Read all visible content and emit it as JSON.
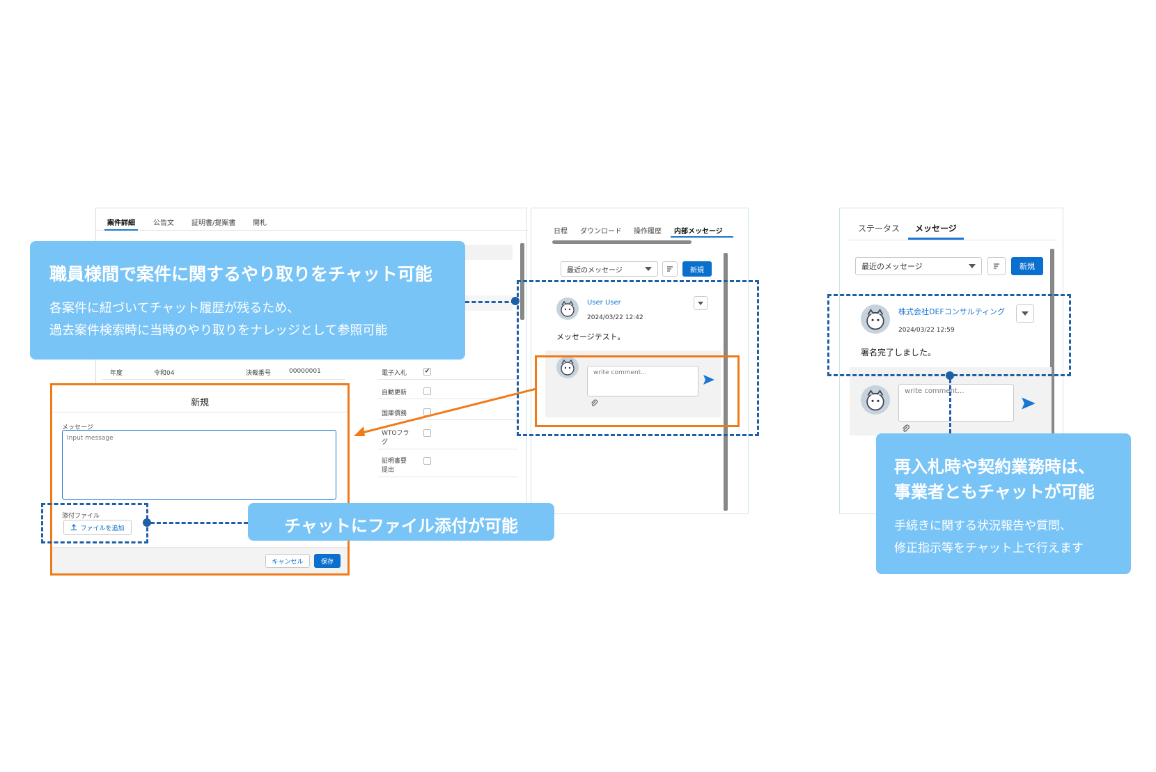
{
  "left_app": {
    "tabs": [
      "案件詳細",
      "公告文",
      "証明書/提案書",
      "開札"
    ],
    "fields": {
      "year_label": "年度",
      "year_value": "令和04",
      "decision_label": "決裁番号",
      "decision_value": "00000001",
      "checks": [
        {
          "label": "電子入札",
          "checked": true,
          "mark": "✔"
        },
        {
          "label": "自動更新",
          "checked": false,
          "mark": ""
        },
        {
          "label": "国庫債務",
          "checked": false,
          "mark": ""
        },
        {
          "label": "WTOフラグ",
          "checked": false,
          "mark": ""
        },
        {
          "label": "証明書要提出",
          "checked": false,
          "mark": ""
        }
      ]
    }
  },
  "modal": {
    "title": "新規",
    "message_label": "メッセージ",
    "message_placeholder": "Input message",
    "attach_label": "添付ファイル",
    "add_file_label": "ファイルを追加",
    "cancel_label": "キャンセル",
    "save_label": "保存"
  },
  "middle_panel": {
    "tabs": [
      "日程",
      "ダウンロード",
      "操作履歴",
      "内部メッセージ"
    ],
    "filter": "最近のメッセージ",
    "new_label": "新規",
    "post": {
      "author": "User User",
      "timestamp": "2024/03/22 12:42",
      "message": "メッセージテスト。"
    },
    "comment_placeholder": "write comment..."
  },
  "right_panel": {
    "tabs": [
      "ステータス",
      "メッセージ"
    ],
    "filter": "最近のメッセージ",
    "new_label": "新規",
    "post": {
      "author": "株式会社DEFコンサルティング",
      "timestamp": "2024/03/22 12:59",
      "message": "署名完了しました。"
    },
    "comment_placeholder": "write comment..."
  },
  "callouts": {
    "top": {
      "title": "職員様間で案件に関するやり取りをチャット可能",
      "line1": "各案件に紐づいてチャット履歴が残るため、",
      "line2": "過去案件検索時に当時のやり取りをナレッジとして参照可能"
    },
    "attach": {
      "title": "チャットにファイル添付が可能"
    },
    "right": {
      "title1": "再入札時や契約業務時は、",
      "title2": "事業者ともチャットが可能",
      "line1": "手続きに関する状況報告や質問、",
      "line2": "修正指示等をチャット上で行えます"
    }
  },
  "colors": {
    "accent_blue": "#0b6fce",
    "callout_blue": "#79c4f6",
    "dash_blue": "#1f5fa8",
    "highlight_orange": "#f07a17"
  }
}
